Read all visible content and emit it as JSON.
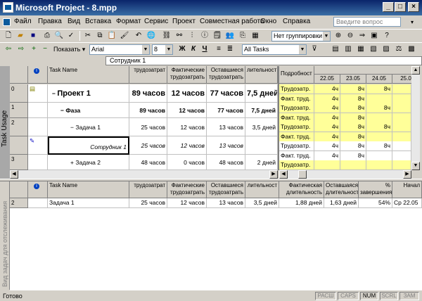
{
  "window": {
    "title": "Microsoft Project - 8.mpp"
  },
  "menu": {
    "items": [
      "Файл",
      "Правка",
      "Вид",
      "Вставка",
      "Формат",
      "Сервис",
      "Проект",
      "Совместная работа",
      "Окно",
      "Справка"
    ],
    "help_placeholder": "Введите вопрос"
  },
  "toolbar": {
    "grouping": "Нет группировки",
    "show": "Показать",
    "font": "Arial",
    "size": "8",
    "bold": "Ж",
    "italic": "К",
    "underline": "Ч",
    "filter": "All Tasks"
  },
  "entry": {
    "value": "Сотрудник 1"
  },
  "top_view": {
    "label": "Task Usage",
    "headers": {
      "task_name": "Task Name",
      "work": "трудозатрат",
      "actual_work": "Фактические трудозатрать",
      "remaining_work": "Оставшиеся трудозатрать",
      "duration": "лительност",
      "details": "Подробност"
    },
    "dates": [
      "22.05",
      "23.05",
      "24.05",
      "25.0"
    ],
    "rows": [
      {
        "id": "0",
        "name": "Проект 1",
        "work": "89 часов",
        "actual": "12 часов",
        "remaining": "77 часов",
        "duration": "7,5 дней"
      },
      {
        "id": "1",
        "name": "Фаза",
        "work": "89 часов",
        "actual": "12 часов",
        "remaining": "77 часов",
        "duration": "7,5 дней"
      },
      {
        "id": "2",
        "name": "Задача 1",
        "work": "25 часов",
        "actual": "12 часов",
        "remaining": "13 часов",
        "duration": "3,5 дней"
      },
      {
        "id": "",
        "name": "Сотрудник 1",
        "work": "25 часов",
        "actual": "12 часов",
        "remaining": "13 часов",
        "duration": ""
      },
      {
        "id": "3",
        "name": "Задача 2",
        "work": "48 часов",
        "actual": "0 часов",
        "remaining": "48 часов",
        "duration": "2 дней"
      }
    ],
    "details": [
      {
        "label": "Трудозатр.",
        "v": [
          "4ч",
          "8ч",
          "8ч",
          ""
        ],
        "y": true
      },
      {
        "label": "Факт. труд.",
        "v": [
          "4ч",
          "8ч",
          "",
          ""
        ],
        "y": true
      },
      {
        "label": "Трудозатр.",
        "v": [
          "4ч",
          "8ч",
          "8ч",
          ""
        ],
        "y": true
      },
      {
        "label": "Факт. труд.",
        "v": [
          "4ч",
          "8ч",
          "",
          ""
        ],
        "y": true
      },
      {
        "label": "Трудозатр.",
        "v": [
          "4ч",
          "8ч",
          "8ч",
          ""
        ],
        "y": true
      },
      {
        "label": "Факт. труд.",
        "v": [
          "4ч",
          "8ч",
          "",
          ""
        ],
        "y": true
      },
      {
        "label": "Трудозатр.",
        "v": [
          "4ч",
          "8ч",
          "8ч",
          ""
        ],
        "y": false
      },
      {
        "label": "Факт. труд.",
        "v": [
          "4ч",
          "8ч",
          "",
          ""
        ],
        "y": false
      },
      {
        "label": "Трудозатр.",
        "v": [
          "",
          "",
          "",
          ""
        ],
        "y": true
      }
    ]
  },
  "bottom_view": {
    "label": "Вид задач для отслеживания",
    "headers": {
      "task_name": "Task Name",
      "work": "трудозатрат",
      "actual_work": "Фактические трудозатрать",
      "remaining_work": "Оставшиеся трудозатрать",
      "duration": "лительност",
      "actual_duration": "Фактическая длительность",
      "remaining_duration": "Оставшаяся длительность",
      "percent": "% завершения",
      "start": "Начал"
    },
    "row": {
      "id": "2",
      "name": "Задача 1",
      "work": "25 часов",
      "actual": "12 часов",
      "remaining": "13 часов",
      "duration": "3,5 дней",
      "actual_duration": "1,88 дней",
      "remaining_duration": "1,63 дней",
      "percent": "54%",
      "start": "Ср 22.05"
    }
  },
  "status": {
    "text": "Готово",
    "panels": [
      "РАСШ",
      "CAPS",
      "NUM",
      "SCRL",
      "ЗАМ"
    ]
  }
}
